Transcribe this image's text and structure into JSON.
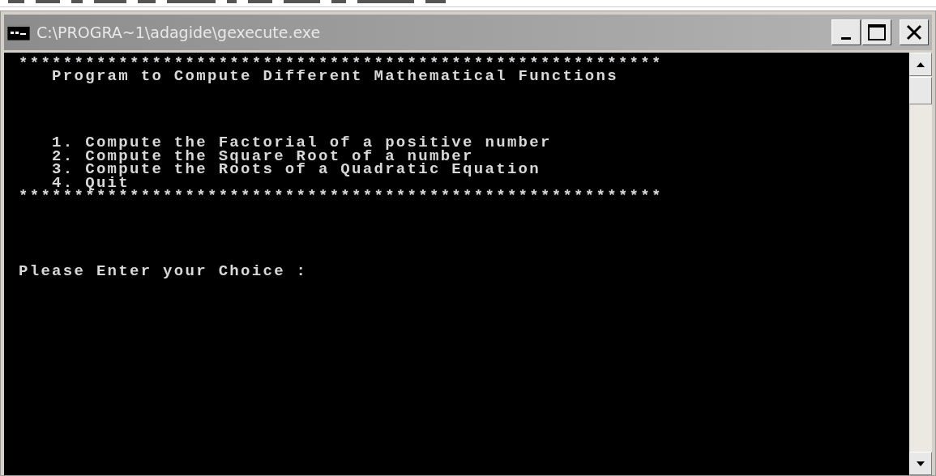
{
  "window": {
    "title": "C:\\PROGRA~1\\adagide\\gexecute.exe"
  },
  "console": {
    "header_rule": "**********************************************************",
    "heading": "   Program to Compute Different Mathematical Functions",
    "menu_items": [
      "   1. Compute the Factorial of a positive number",
      "   2. Compute the Square Root of a number",
      "   3. Compute the Roots of a Quadratic Equation",
      "   4. Quit"
    ],
    "footer_rule": "**********************************************************",
    "prompt": "Please Enter your Choice :"
  }
}
